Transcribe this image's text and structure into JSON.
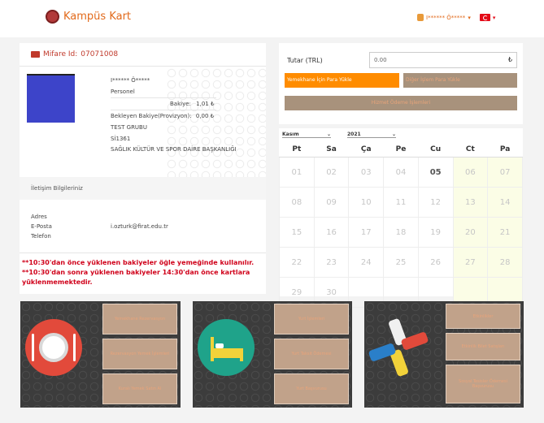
{
  "header": {
    "brand": "Kampüs Kart",
    "user": "I****** Ö*****"
  },
  "card": {
    "mifare_label": "Mifare Id:",
    "mifare_id": "07071008",
    "name": "I****** Ö*****",
    "role": "Personel",
    "balance_label": "Bakiye:",
    "balance_value": "1,01 ₺",
    "pending_label": "Bekleyen Bakiye(Provizyon):",
    "pending_value": "0,00 ₺",
    "group": "TEST GRUBU",
    "code": "Sİ1361",
    "department": "SAĞLIK KÜLTÜR VE SPOR DAİRE BAŞKANLIĞI"
  },
  "contact": {
    "title": "İletişim Bilgileriniz",
    "address_label": "Adres",
    "email_label": "E-Posta",
    "email": "i.ozturk@firat.edu.tr",
    "phone_label": "Telefon"
  },
  "warnings": [
    "**10:30'dan önce yüklenen bakiyeler öğle yemeğinde kullanılır.",
    "**10:30'dan sonra yüklenen bakiyeler 14:30'dan önce kartlara yüklenmemektedir."
  ],
  "payment": {
    "amount_label": "Tutar (TRL)",
    "amount_value": "0.00",
    "btn_meal": "Yemekhane İçin Para Yükle",
    "btn_other": "Diğer İşlem Para Yükle",
    "btn_wide": "Hizmet Ödeme İşlemleri"
  },
  "calendar": {
    "month": "Kasım",
    "year": "2021",
    "weekdays": [
      "Pt",
      "Sa",
      "Ça",
      "Pe",
      "Cu",
      "Ct",
      "Pa"
    ],
    "weeks": [
      [
        "01",
        "02",
        "03",
        "04",
        "05",
        "06",
        "07"
      ],
      [
        "08",
        "09",
        "10",
        "11",
        "12",
        "13",
        "14"
      ],
      [
        "15",
        "16",
        "17",
        "18",
        "19",
        "20",
        "21"
      ],
      [
        "22",
        "23",
        "24",
        "25",
        "26",
        "27",
        "28"
      ],
      [
        "29",
        "30",
        "",
        "",
        "",
        "",
        ""
      ]
    ],
    "today": "05"
  },
  "tiles": [
    {
      "buttons": [
        "Yemekhane Rezervasyon",
        "Rezervasyon Yemek İşlemleri",
        "Kuralı Yemek Satın Al"
      ]
    },
    {
      "buttons": [
        "Yurt İşlemleri",
        "Yurt Taksit Ödemesi",
        "Yurt Başvurusu"
      ]
    },
    {
      "buttons": [
        "Etkinlikler",
        "Etkinlik Bilet Satışları",
        "Sosyal Tesisler Ödemesi Başvurusu"
      ]
    }
  ],
  "colors": {
    "accent": "#e26a1b",
    "orange_btn": "#ff8c00",
    "brown_btn": "#a8927c",
    "tile_bg": "#3c3c3c"
  }
}
